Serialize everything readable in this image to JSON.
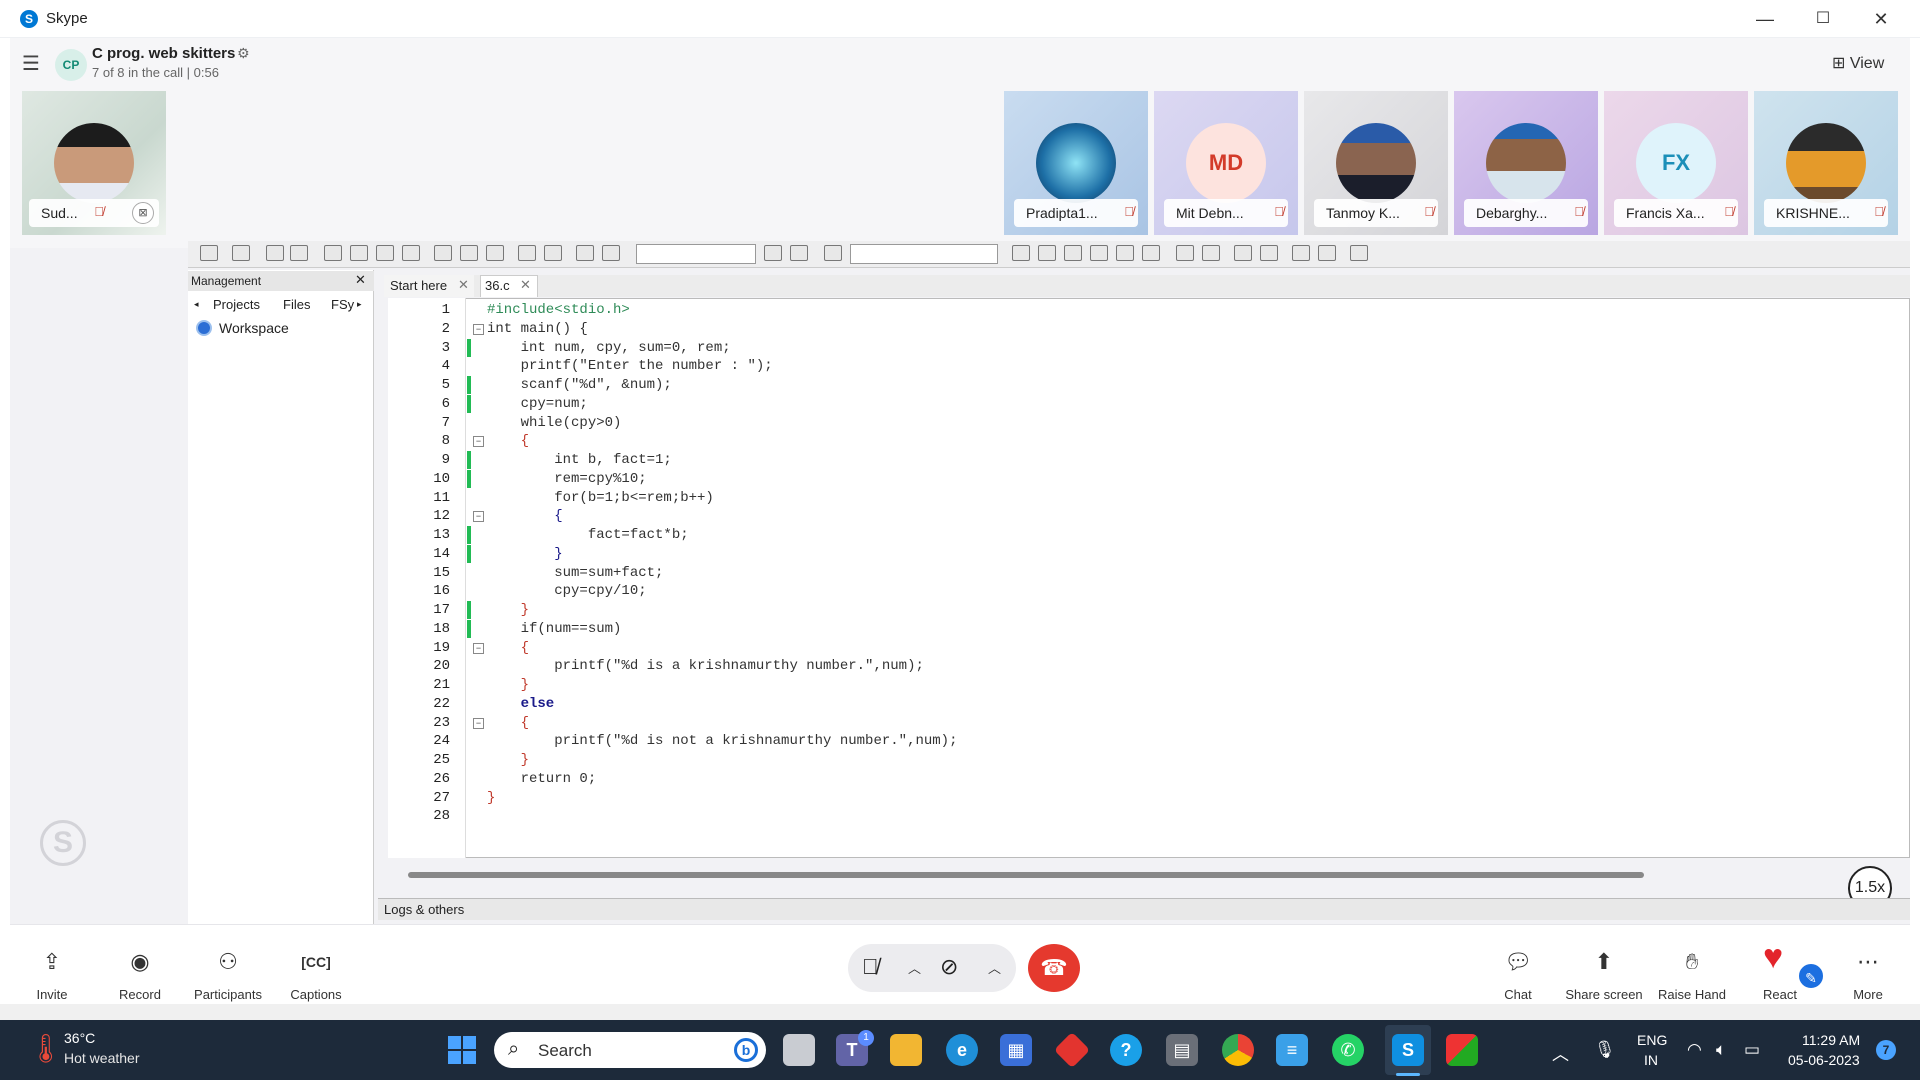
{
  "window": {
    "app_title": "Skype",
    "minimize_icon": "minimize-icon",
    "maximize_icon": "maximize-icon",
    "close_icon": "close-icon"
  },
  "call": {
    "group_initials": "CP",
    "group_name": "C prog. web skitters",
    "status": "7 of 8 in the call | 0:56",
    "view_label": "View"
  },
  "participants": [
    {
      "name": "Sud...",
      "muted": true
    },
    {
      "name": "Pradipta1...",
      "muted": true
    },
    {
      "name": "Mit Debn...",
      "initials": "MD",
      "muted": true
    },
    {
      "name": "Tanmoy K...",
      "muted": true
    },
    {
      "name": "Debarghy...",
      "muted": true
    },
    {
      "name": "Francis Xa...",
      "initials": "FX",
      "muted": true
    },
    {
      "name": "KRISHNE...",
      "muted": true
    }
  ],
  "ide": {
    "panel_title": "Management",
    "panel_tabs": [
      "Projects",
      "Files",
      "FSy"
    ],
    "workspace_label": "Workspace",
    "editor_tabs": [
      "Start here",
      "36.c"
    ],
    "logs_label": "Logs & others",
    "line_numbers": [
      "1",
      "2",
      "3",
      "4",
      "5",
      "6",
      "7",
      "8",
      "9",
      "10",
      "11",
      "12",
      "13",
      "14",
      "15",
      "16",
      "17",
      "18",
      "19",
      "20",
      "21",
      "22",
      "23",
      "24",
      "25",
      "26",
      "27",
      "28"
    ],
    "code_lines": [
      "#include<stdio.h>",
      "int main() {",
      "    int num, cpy, sum=0, rem;",
      "    printf(\"Enter the number : \");",
      "    scanf(\"%d\", &num);",
      "    cpy=num;",
      "    while(cpy>0)",
      "    {",
      "        int b, fact=1;",
      "        rem=cpy%10;",
      "        for(b=1;b<=rem;b++)",
      "        {",
      "            fact=fact*b;",
      "        }",
      "        sum=sum+fact;",
      "        cpy=cpy/10;",
      "    }",
      "    if(num==sum)",
      "    {",
      "        printf(\"%d is a krishnamurthy number.\",num);",
      "    }",
      "    else",
      "    {",
      "        printf(\"%d is not a krishnamurthy number.\",num);",
      "    }",
      "    return 0;",
      "}",
      ""
    ],
    "playback_speed": "1.5x"
  },
  "controls": {
    "invite": "Invite",
    "record": "Record",
    "participants": "Participants",
    "captions": "Captions",
    "chat": "Chat",
    "share_screen": "Share screen",
    "raise_hand": "Raise Hand",
    "react": "React",
    "more": "More"
  },
  "taskbar": {
    "temperature": "36°C",
    "weather": "Hot weather",
    "search_placeholder": "Search",
    "teams_badge": "1",
    "lang_top": "ENG",
    "lang_bottom": "IN",
    "time": "11:29 AM",
    "date": "05-06-2023",
    "notification_count": "7"
  }
}
